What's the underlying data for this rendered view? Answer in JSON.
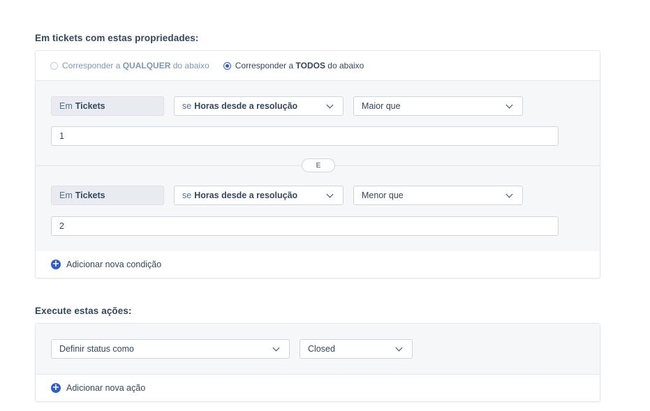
{
  "triggers": {
    "title": "Em tickets com estas propriedades:",
    "match": {
      "any": {
        "prefix": "Corresponder a ",
        "bold": "QUALQUER",
        "suffix": " do abaixo",
        "selected": false
      },
      "all": {
        "prefix": "Corresponder a ",
        "bold": "TODOS",
        "suffix": " do abaixo",
        "selected": true
      }
    },
    "conditions": [
      {
        "object_prefix": "Em",
        "object": "Tickets",
        "field_prefix": "se",
        "field": "Horas desde a resolução",
        "operator": "Maior que",
        "value": "1"
      },
      {
        "object_prefix": "Em",
        "object": "Tickets",
        "field_prefix": "se",
        "field": "Horas desde a resolução",
        "operator": "Menor que",
        "value": "2"
      }
    ],
    "joiner": "E",
    "add_condition": "Adicionar nova condição"
  },
  "actions": {
    "title": "Execute estas ações:",
    "items": [
      {
        "action": "Definir status como",
        "value": "Closed"
      }
    ],
    "add_action": "Adicionar nova ação"
  },
  "colors": {
    "accent": "#2e5bd3",
    "text": "#33475b",
    "muted": "#7c98b6",
    "panel": "#f5f7f9"
  },
  "icons": {
    "add": "plus-circle-icon",
    "dropdown": "chevron-down-icon"
  }
}
